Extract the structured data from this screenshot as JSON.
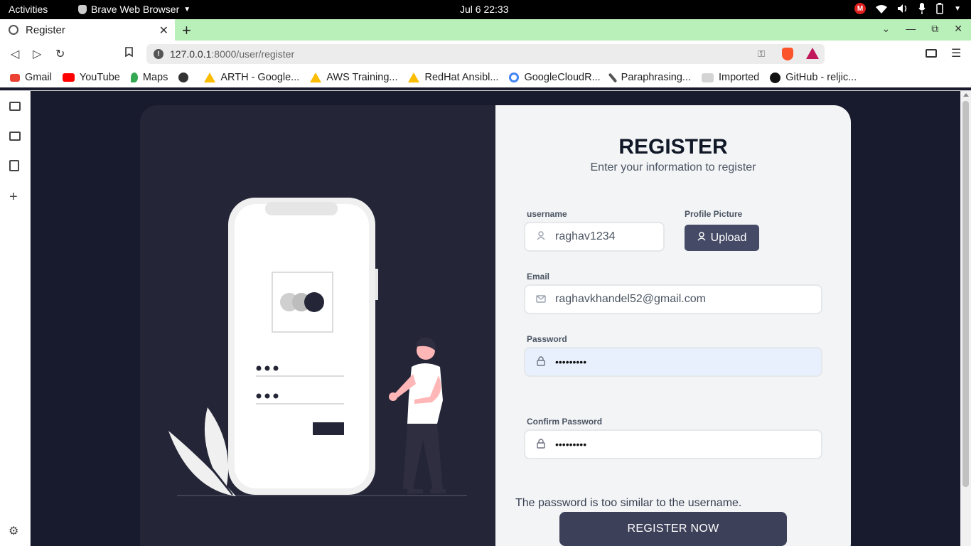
{
  "system_bar": {
    "activities": "Activities",
    "app_name": "Brave Web Browser",
    "clock": "Jul 6  22:33",
    "badge": "M"
  },
  "browser": {
    "tab_title": "Register",
    "url_host": "127.0.0.1",
    "url_rest": ":8000/user/register"
  },
  "bookmarks": [
    {
      "label": "Gmail",
      "icon": "gmail-icon",
      "color": "#ea4335"
    },
    {
      "label": "YouTube",
      "icon": "youtube-icon",
      "color": "#ff0000"
    },
    {
      "label": "Maps",
      "icon": "maps-icon",
      "color": "#34a853"
    },
    {
      "label": "",
      "icon": "globe-icon",
      "color": "#333333"
    },
    {
      "label": "ARTH - Google...",
      "icon": "google-drive-icon",
      "color": "#fbbc04"
    },
    {
      "label": "AWS Training...",
      "icon": "google-drive-icon",
      "color": "#fbbc04"
    },
    {
      "label": "RedHat Ansibl...",
      "icon": "google-drive-icon",
      "color": "#fbbc04"
    },
    {
      "label": "GoogleCloudR...",
      "icon": "google-icon",
      "color": "#4285f4"
    },
    {
      "label": "Paraphrasing...",
      "icon": "feather-icon",
      "color": "#555555"
    },
    {
      "label": "Imported",
      "icon": "folder-icon",
      "color": "#cccccc"
    },
    {
      "label": "GitHub - reljic...",
      "icon": "github-icon",
      "color": "#111111"
    }
  ],
  "form": {
    "title": "REGISTER",
    "subtitle": "Enter your information to register",
    "username_label": "username",
    "username_value": "raghav1234",
    "profile_label": "Profile Picture",
    "upload_label": "Upload",
    "email_label": "Email",
    "email_value": "raghavkhandel52@gmail.com",
    "password_label": "Password",
    "password_value": "•••••••••",
    "confirm_label": "Confirm Password",
    "confirm_value": "•••••••••",
    "error": "The password is too similar to the username.",
    "submit": "REGISTER NOW"
  },
  "colors": {
    "page_bg": "#181a2e",
    "card_left": "#242638",
    "card_right": "#f3f4f6",
    "button": "#3d4059",
    "tab_bar": "#b9f0b9"
  }
}
